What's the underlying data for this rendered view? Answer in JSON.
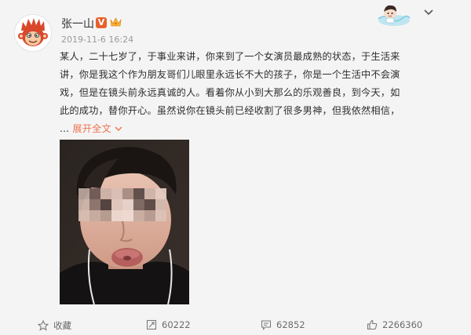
{
  "user": {
    "name": "张一山",
    "verified_mark": "V",
    "avatar_icon": "monkey-king-avatar",
    "timestamp": "2019-11-6 16:24"
  },
  "post": {
    "lines": [
      "某人，二十七岁了，于事业来讲，你来到了一个女演员最成熟的状态，于生活来",
      "讲，你是我这个作为朋友哥们儿眼里永远长不大的孩子，你是一个生活中不会演",
      "戏，但是在镜头前永远真诚的人。看着你从小到大那么的乐观善良，到今天，如",
      "此的成功，替你开心。虽然说你在镜头前已经收割了很多男神，但我依然相信，"
    ],
    "ellipsis": "...",
    "expand_label": "展开全文"
  },
  "actions": {
    "favorite_label": "收藏",
    "repost_count": "60222",
    "comment_count": "62852",
    "like_count": "2266360"
  },
  "colors": {
    "accent": "#eb7350",
    "verify": "#e8612c",
    "background": "#f5f4f4"
  }
}
